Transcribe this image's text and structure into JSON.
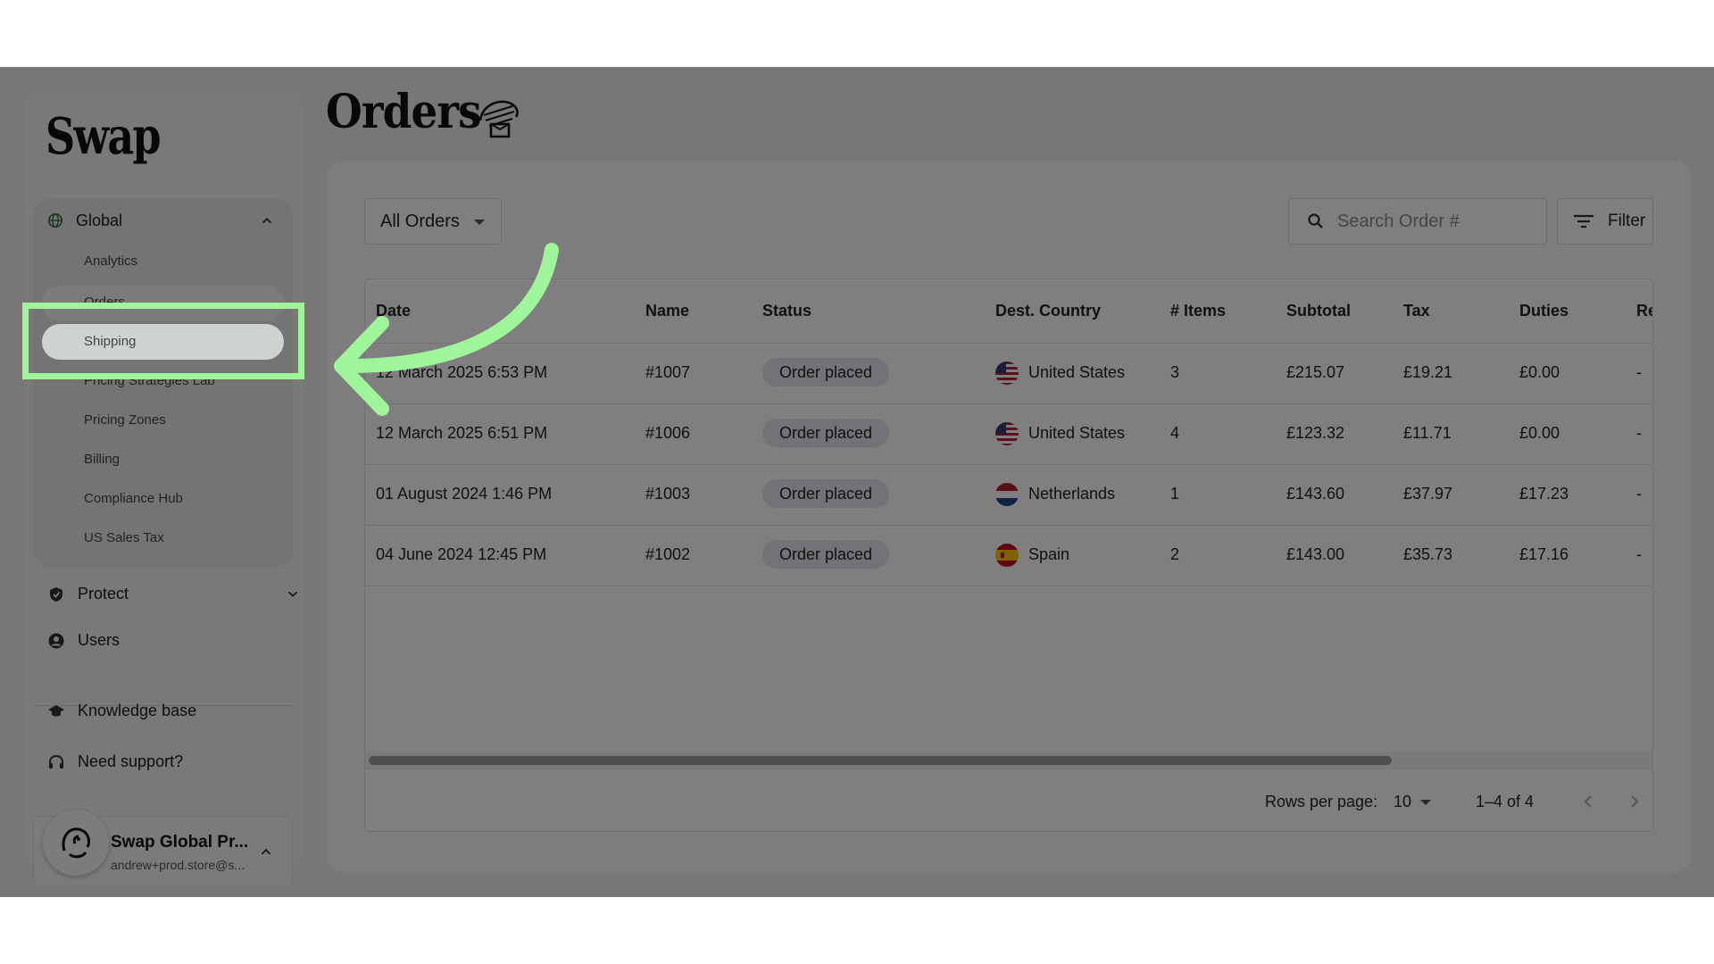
{
  "brand": {
    "logo": "Swap"
  },
  "sidebar": {
    "global": {
      "label": "Global",
      "items": [
        "Analytics",
        "Orders",
        "Shipping",
        "Pricing Strategies Lab",
        "Pricing Zones",
        "Billing",
        "Compliance Hub",
        "US Sales Tax"
      ]
    },
    "protect": "Protect",
    "users": "Users",
    "knowledge": "Knowledge base",
    "support": "Need support?",
    "account": {
      "name": "Swap Global Pr...",
      "email": "andrew+prod.store@s..."
    }
  },
  "page": {
    "title": "Orders"
  },
  "toolbar": {
    "view_select": "All Orders",
    "search_placeholder": "Search Order #",
    "filter_label": "Filter"
  },
  "table": {
    "columns": [
      "Date",
      "Name",
      "Status",
      "Dest. Country",
      "# Items",
      "Subtotal",
      "Tax",
      "Duties",
      "Re"
    ],
    "rows": [
      {
        "date": "12 March 2025 6:53 PM",
        "name": "#1007",
        "status": "Order placed",
        "country": "United States",
        "items": "3",
        "subtotal": "£215.07",
        "tax": "£19.21",
        "duties": "£0.00",
        "re": "-"
      },
      {
        "date": "12 March 2025 6:51 PM",
        "name": "#1006",
        "status": "Order placed",
        "country": "United States",
        "items": "4",
        "subtotal": "£123.32",
        "tax": "£11.71",
        "duties": "£0.00",
        "re": "-"
      },
      {
        "date": "01 August 2024 1:46 PM",
        "name": "#1003",
        "status": "Order placed",
        "country": "Netherlands",
        "items": "1",
        "subtotal": "£143.60",
        "tax": "£37.97",
        "duties": "£17.23",
        "re": "-"
      },
      {
        "date": "04 June 2024 12:45 PM",
        "name": "#1002",
        "status": "Order placed",
        "country": "Spain",
        "items": "2",
        "subtotal": "£143.00",
        "tax": "£35.73",
        "duties": "£17.16",
        "re": "-"
      }
    ],
    "footer": {
      "rows_per_page_label": "Rows per page:",
      "rows_per_page": "10",
      "range": "1–4 of 4"
    }
  },
  "colors": {
    "highlight": "#9ef59a",
    "badge_bg": "#e3e6ed",
    "overlay": "rgba(0,0,0,0.5)"
  }
}
